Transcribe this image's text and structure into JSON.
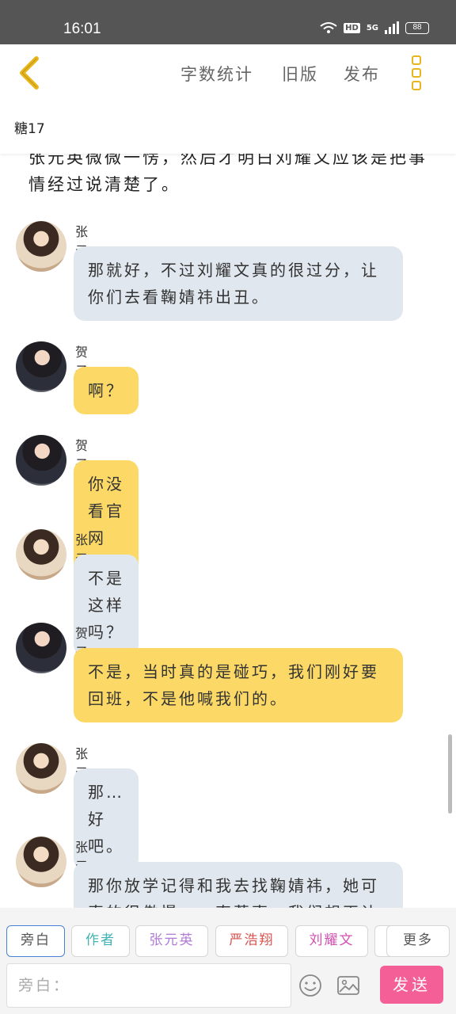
{
  "status_bar": {
    "time": "16:01",
    "hd": "HD",
    "network": "5G",
    "battery": "88"
  },
  "header": {
    "word_count_label": "字数统计",
    "old_version_label": "旧版",
    "publish_label": "发布"
  },
  "story_title": "糖17",
  "narration_fragment": "张元英微微一愣，然后才明白刘耀文应该是把事情经过说清楚了。",
  "messages": [
    {
      "sender": "张元英",
      "text": "那就好，不过刘耀文真的很过分，让你们去看鞠婧祎出丑。"
    },
    {
      "sender": "贺子淑",
      "text": "啊？"
    },
    {
      "sender": "贺子淑",
      "text": "你没看官网吗？"
    },
    {
      "sender": "张元英",
      "text": "不是这样吗？"
    },
    {
      "sender": "贺子淑",
      "text": "不是，当时真的是碰巧，我们刚好要回班，不是他喊我们的。"
    },
    {
      "sender": "张元英",
      "text": "那…好吧。"
    },
    {
      "sender": "张元英",
      "text": "那你放学记得和我去找鞠婧祎，她可真的很傲慢，一直惹事，我们想再让刘耀文…"
    }
  ],
  "roles": [
    {
      "label": "旁白",
      "color": "#555555"
    },
    {
      "label": "作者",
      "color": "#3fb3b1"
    },
    {
      "label": "张元英",
      "color": "#b07ad6"
    },
    {
      "label": "严浩翔",
      "color": "#d9534f"
    },
    {
      "label": "刘耀文",
      "color": "#d24fb0"
    },
    {
      "label": "",
      "color": "#999999"
    }
  ],
  "more_label": "更多",
  "composer": {
    "placeholder": "旁白：",
    "value": "",
    "send_label": "发送"
  },
  "colors": {
    "accent_yellow": "#e8b61c",
    "bubble_yellow": "#fcd967",
    "bubble_blue": "#e1e7ee",
    "send_pink": "#f55f98"
  }
}
